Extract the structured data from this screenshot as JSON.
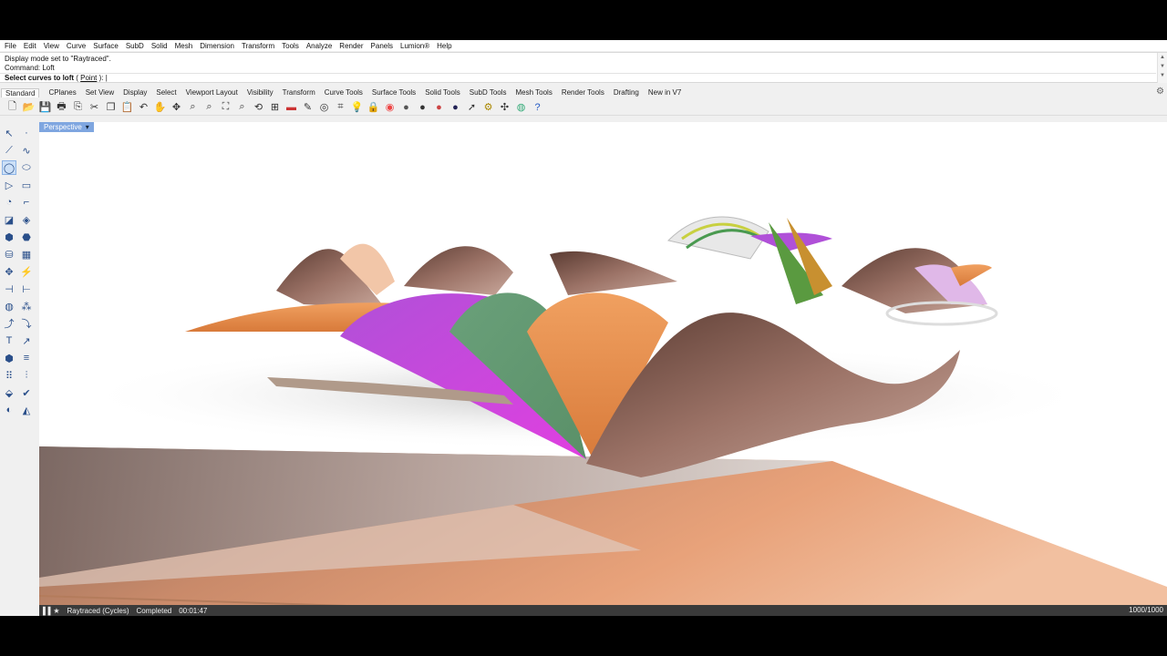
{
  "menu": [
    "File",
    "Edit",
    "View",
    "Curve",
    "Surface",
    "SubD",
    "Solid",
    "Mesh",
    "Dimension",
    "Transform",
    "Tools",
    "Analyze",
    "Render",
    "Panels",
    "Lumion®",
    "Help"
  ],
  "command": {
    "history_line1": "Display mode set to \"Raytraced\".",
    "history_line2": "Command: Loft",
    "prompt": "Select curves to loft",
    "option_open": " ( ",
    "option": "Point",
    "option_close": " ):"
  },
  "toolbar_tabs": [
    "Standard",
    "CPlanes",
    "Set View",
    "Display",
    "Select",
    "Viewport Layout",
    "Visibility",
    "Transform",
    "Curve Tools",
    "Surface Tools",
    "Solid Tools",
    "SubD Tools",
    "Mesh Tools",
    "Render Tools",
    "Drafting",
    "New in V7"
  ],
  "toolbar_icons": [
    "new-file-icon",
    "open-file-icon",
    "save-icon",
    "print-icon",
    "import-icon",
    "cut-icon",
    "copy-icon",
    "paste-icon",
    "undo-icon",
    "pan-icon",
    "rotate-view-icon",
    "zoom-icon",
    "zoom-window-icon",
    "zoom-extents-icon",
    "zoom-selected-icon",
    "undo-view-icon",
    "four-views-icon",
    "car-icon",
    "paint-icon",
    "cplane-icon",
    "grid-icon",
    "light-bulb-icon",
    "lock-icon",
    "color-wheel-icon",
    "render-sphere-icon",
    "render-sphere-dark-icon",
    "material-sphere-icon",
    "render-sphere-blue-icon",
    "cursor-options-icon",
    "gear-settings-icon",
    "move-icon",
    "globe-icon",
    "help-icon"
  ],
  "viewport": {
    "name": "Perspective",
    "menu_glyph": "▾"
  },
  "status": {
    "mode": "Raytraced (Cycles)",
    "state": "Completed",
    "time": "00:01:47",
    "passes": "1000/1000"
  }
}
